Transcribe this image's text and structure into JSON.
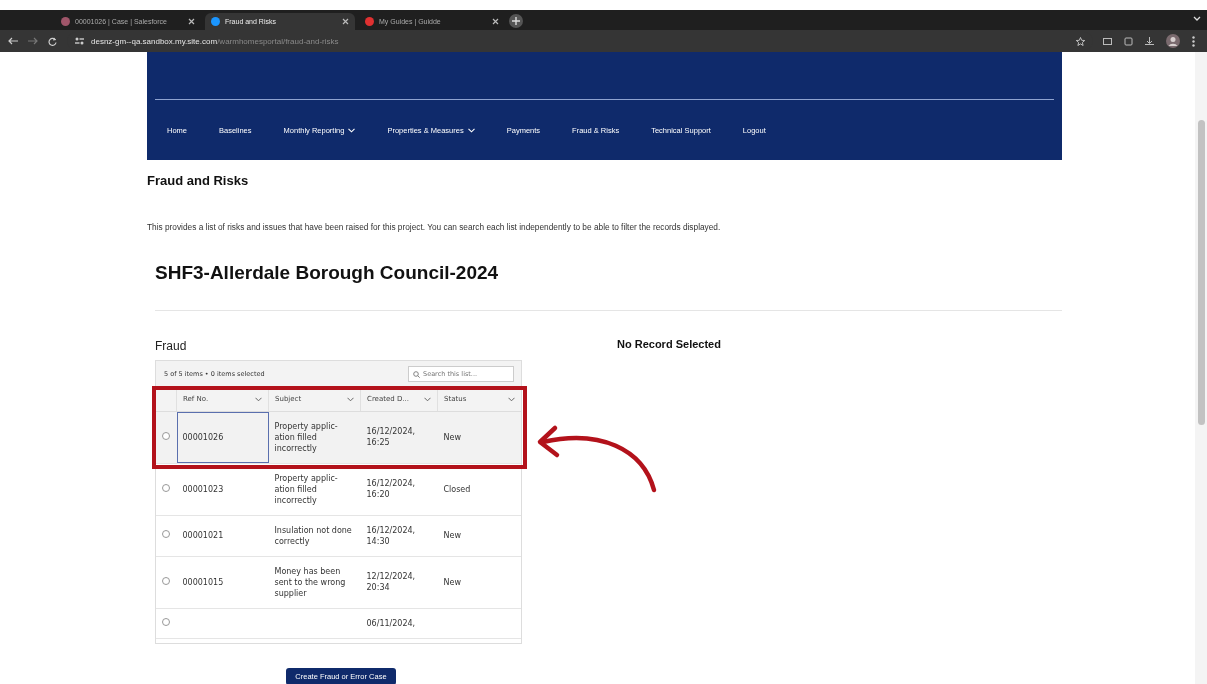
{
  "browser": {
    "tabs": [
      {
        "title": "00001026 | Case | Salesforce",
        "selected": false
      },
      {
        "title": "Fraud and Risks",
        "selected": true
      },
      {
        "title": "My Guides | Guidde",
        "selected": false
      }
    ],
    "url_host": "desnz-gm--qa.sandbox.my.site.com",
    "url_path": "/warmhomesportal/fraud-and-risks"
  },
  "nav": {
    "items": [
      {
        "label": "Home",
        "dropdown": false
      },
      {
        "label": "Baselines",
        "dropdown": false
      },
      {
        "label": "Monthly Reporting",
        "dropdown": true
      },
      {
        "label": "Properties & Measures",
        "dropdown": true
      },
      {
        "label": "Payments",
        "dropdown": false
      },
      {
        "label": "Fraud & Risks",
        "dropdown": false
      },
      {
        "label": "Technical Support",
        "dropdown": false
      },
      {
        "label": "Logout",
        "dropdown": false
      }
    ]
  },
  "page": {
    "heading": "Fraud and Risks",
    "description": "This provides a list of risks and issues that have been raised for this project. You can search each list independently to be able to filter the records displayed.",
    "project_title": "SHF3-Allerdale Borough Council-2024"
  },
  "fraud": {
    "title": "Fraud",
    "summary": "5 of 5 items • 0 items selected",
    "search": {
      "placeholder": "Search this list..."
    },
    "columns": [
      "Ref No.",
      "Subject",
      "Created D...",
      "Status"
    ],
    "rows": [
      {
        "ref": "00001026",
        "subject": "Property applic-ation filled incorrectly",
        "created": "16/12/2024, 16:25",
        "status": "New",
        "highlighted": true,
        "focused": true,
        "checked": false
      },
      {
        "ref": "00001023",
        "subject": "Property applic-ation filled incorrectly",
        "created": "16/12/2024, 16:20",
        "status": "Closed",
        "highlighted": false,
        "focused": false,
        "checked": false
      },
      {
        "ref": "00001021",
        "subject": "Insulation not done correctly",
        "created": "16/12/2024, 14:30",
        "status": "New",
        "highlighted": false,
        "focused": false,
        "checked": false
      },
      {
        "ref": "00001015",
        "subject": "Money has been sent to the wrong supplier",
        "created": "12/12/2024, 20:34",
        "status": "New",
        "highlighted": false,
        "focused": false,
        "checked": false
      },
      {
        "created": "06/11/2024,",
        "highlighted": false,
        "focused": false,
        "checked": false
      }
    ],
    "button": "Create Fraud or Error Case"
  },
  "detail": {
    "title": "No Record Selected"
  }
}
